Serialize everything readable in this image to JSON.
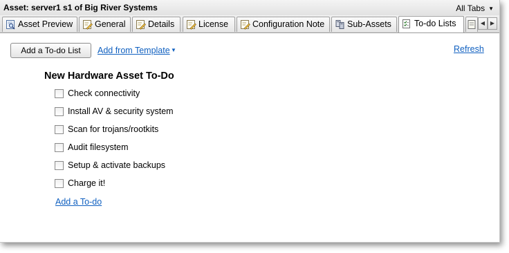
{
  "window": {
    "title": "Asset: server1 s1 of Big River Systems",
    "all_tabs_label": "All Tabs"
  },
  "tabs": [
    {
      "label": "Asset Preview",
      "icon": "asset-preview-icon"
    },
    {
      "label": "General",
      "icon": "edit-form-icon"
    },
    {
      "label": "Details",
      "icon": "edit-form-icon"
    },
    {
      "label": "License",
      "icon": "edit-form-icon"
    },
    {
      "label": "Configuration Note",
      "icon": "edit-form-icon"
    },
    {
      "label": "Sub-Assets",
      "icon": "sub-assets-icon"
    },
    {
      "label": "To-do Lists",
      "icon": "todo-list-icon",
      "active": true
    }
  ],
  "toolbar": {
    "add_list_label": "Add a To-do List",
    "add_template_label": "Add from Template",
    "refresh_label": "Refresh"
  },
  "todo_list": {
    "title": "New Hardware Asset To-Do",
    "items": [
      {
        "label": "Check connectivity",
        "checked": false
      },
      {
        "label": "Install AV & security system",
        "checked": false
      },
      {
        "label": "Scan for trojans/rootkits",
        "checked": false
      },
      {
        "label": "Audit filesystem",
        "checked": false
      },
      {
        "label": "Setup & activate backups",
        "checked": false
      },
      {
        "label": "Charge it!",
        "checked": false
      }
    ],
    "add_todo_label": "Add a To-do"
  },
  "colors": {
    "link": "#1060c0",
    "tab_border": "#a0a0a0",
    "titlebar": "#e8e8e8"
  }
}
